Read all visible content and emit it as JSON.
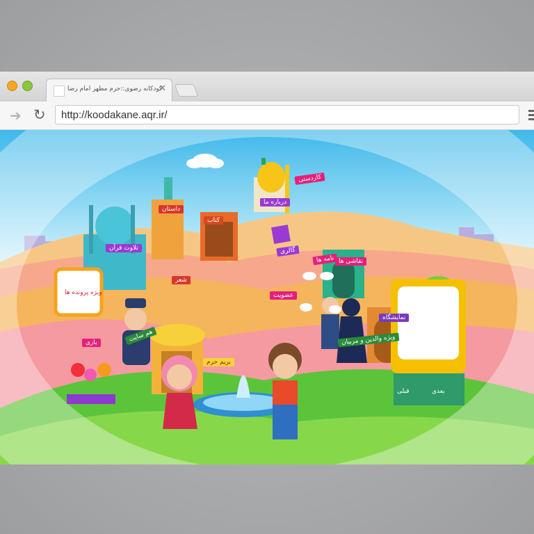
{
  "browser": {
    "tab_title": "کودکانه رضوی::حرم مطهر امام رضا",
    "url": "http://koodakane.aqr.ir/"
  },
  "scene": {
    "labels": {
      "kardasti": "کاردستی",
      "darbare_ma": "درباره ما",
      "naqqashi": "نقاشی ها",
      "dastan": "داستان",
      "ketab": "کتاب",
      "telavat": "تلاوت قرآن",
      "gallery": "گالری",
      "nameha": "نامه ها",
      "namayeshgah": "نمایشگاه",
      "vizheh_parvandeh": "ویژه پرونده ها",
      "sher": "شعر",
      "ozviyat": "عضویت",
      "bazi": "بازی",
      "hamsayat": "هم سایت",
      "vizheh_valedin": "ویژه والدین و مربیان",
      "berim_haram": "بریم حرم",
      "badi": "بعدی",
      "qabli": "قبلی"
    }
  },
  "colors": {
    "sky": "#3fb8ea",
    "grass": "#5cc43a",
    "accent_pink": "#e4207a"
  }
}
